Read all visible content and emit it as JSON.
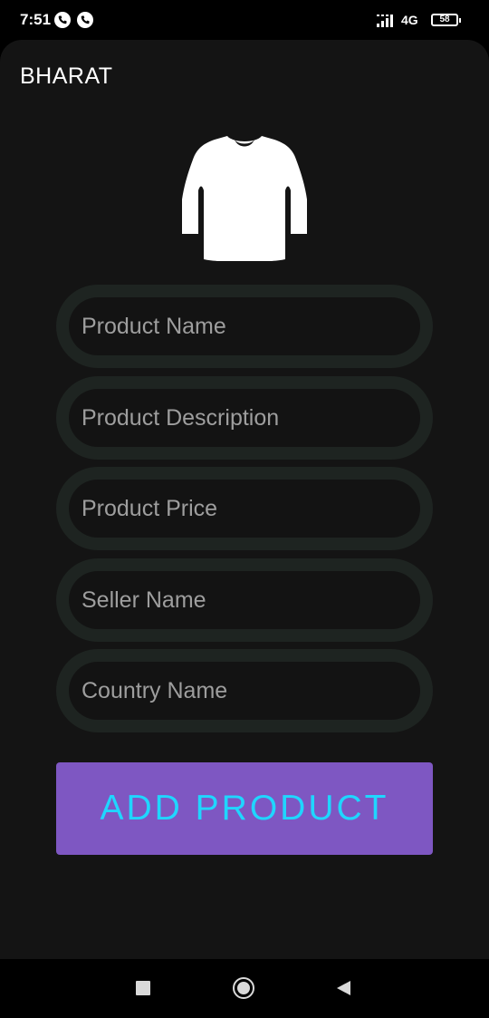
{
  "status_bar": {
    "time": "7:51",
    "network": "4G",
    "battery": "58",
    "icons": [
      "whatsapp-call-icon",
      "whatsapp-call-icon",
      "signal-icon",
      "battery-icon"
    ]
  },
  "app": {
    "title": "BHARAT",
    "header_icon": "shirt-icon",
    "fields": {
      "product_name": {
        "placeholder": "Product Name",
        "value": ""
      },
      "product_description": {
        "placeholder": "Product Description",
        "value": ""
      },
      "product_price": {
        "placeholder": "Product Price",
        "value": ""
      },
      "seller_name": {
        "placeholder": "Seller Name",
        "value": ""
      },
      "country_name": {
        "placeholder": "Country Name",
        "value": ""
      }
    },
    "add_button_label": "ADD PRODUCT"
  },
  "nav_bar": {
    "icons": [
      "recents-icon",
      "home-icon",
      "back-icon"
    ]
  },
  "colors": {
    "background": "#141414",
    "field_border": "#1e2421",
    "button": "#7e57c2",
    "button_text": "#1fd6ff"
  }
}
